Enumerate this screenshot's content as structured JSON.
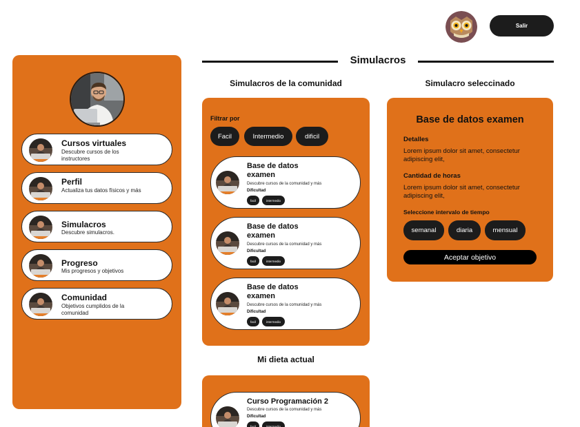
{
  "header": {
    "logout_label": "Salir",
    "page_title": "Simulacros"
  },
  "sidebar": {
    "items": [
      {
        "title": "Cursos virtuales",
        "desc": "Descubre cursos de los instructores"
      },
      {
        "title": "Perfil",
        "desc": "Actualiza tus datos físicos y más"
      },
      {
        "title": "Simulacros",
        "desc": "Descubre simulacros."
      },
      {
        "title": "Progreso",
        "desc": "Mis progresos y objetivos"
      },
      {
        "title": "Comunidad",
        "desc": "Objetivos cumplidos de la comunidad"
      }
    ]
  },
  "community": {
    "heading": "Simulacros de la comunidad",
    "filter_label": "Filtrar por",
    "filters": [
      "Facil",
      "Intermedio",
      "dificil"
    ],
    "cards": [
      {
        "title": "Base de datos examen",
        "desc": "Descubre cursos de la comunidad y más",
        "difficulty_label": "Dificultad",
        "tags": [
          "facil",
          "intermedio"
        ]
      },
      {
        "title": "Base de datos examen",
        "desc": "Descubre cursos de la comunidad y más",
        "difficulty_label": "Dificultad",
        "tags": [
          "facil",
          "intermedio"
        ]
      },
      {
        "title": "Base de datos examen",
        "desc": "Descubre cursos de la comunidad y más",
        "difficulty_label": "Dificultad",
        "tags": [
          "facil",
          "intermedio"
        ]
      }
    ]
  },
  "diet": {
    "heading": "Mi dieta actual",
    "cards": [
      {
        "title": "Curso Programación 2",
        "desc": "Descubre cursos de la comunidad y más",
        "difficulty_label": "Dificultad",
        "tags": [
          "facil",
          "intermedio"
        ]
      }
    ]
  },
  "selected": {
    "heading": "Simulacro seleccinado",
    "title": "Base de datos examen",
    "details_label": "Detalles",
    "details_text": "Lorem ipsum dolor sit amet, consectetur adipiscing elit,",
    "hours_label": "Cantidad de horas",
    "hours_text": "Lorem ipsum dolor sit amet, consectetur adipiscing elit,",
    "interval_label": "Seleccione intervalo de tiempo",
    "intervals": [
      "semanal",
      "diaria",
      "mensual"
    ],
    "accept_label": "Aceptar objetivo"
  },
  "colors": {
    "accent": "#e0711a",
    "dark": "#1c1c1c"
  },
  "icons": {
    "avatar": "owl-icon",
    "profile": "person-photo",
    "thumb": "laptop-icon"
  }
}
